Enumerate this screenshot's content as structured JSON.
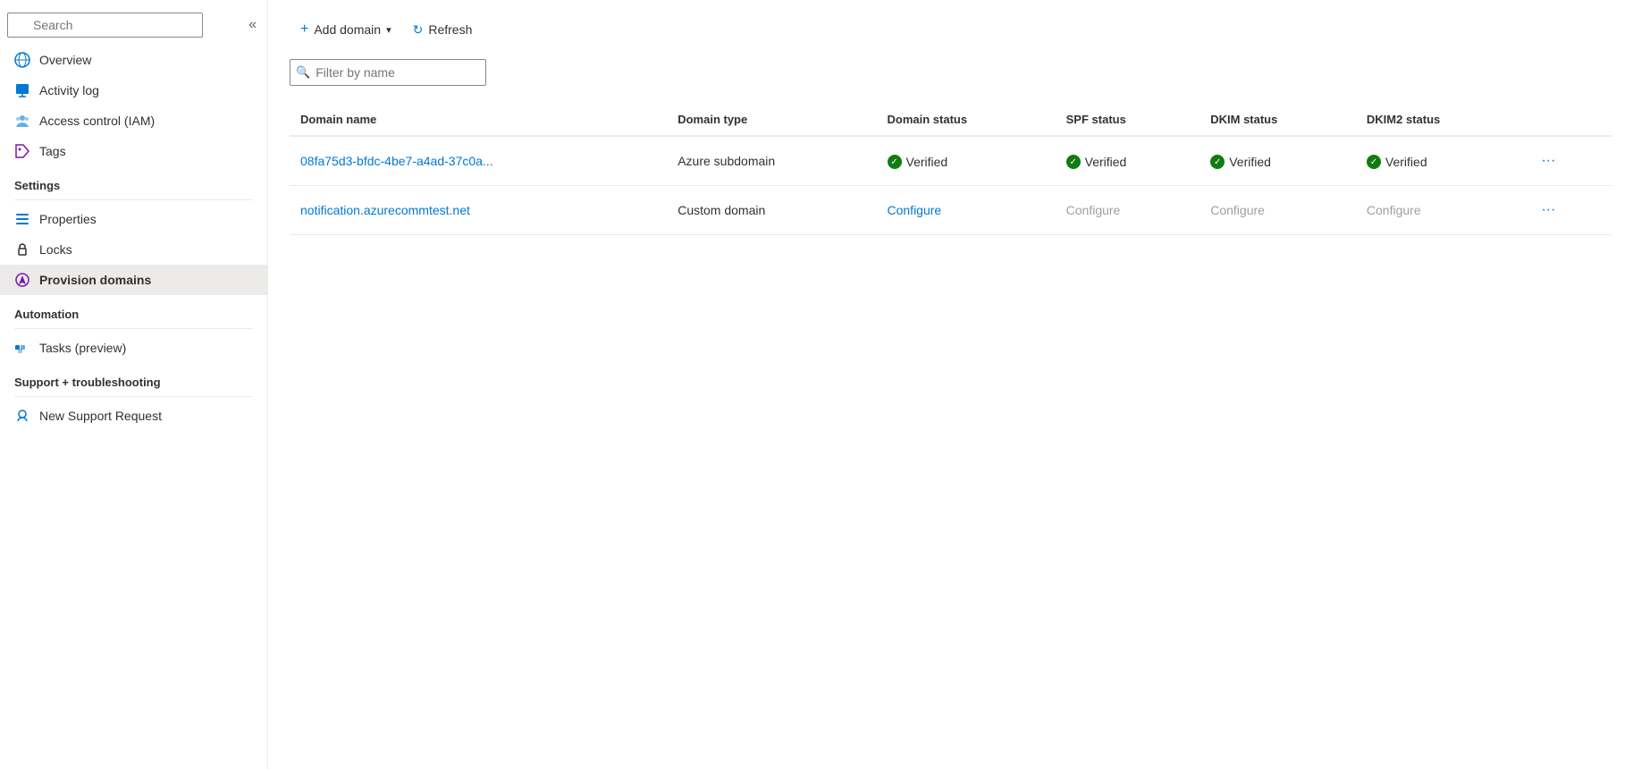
{
  "sidebar": {
    "search": {
      "placeholder": "Search",
      "value": ""
    },
    "collapse_label": "«",
    "nav_items": [
      {
        "id": "overview",
        "label": "Overview",
        "icon": "globe-icon",
        "active": false
      },
      {
        "id": "activity-log",
        "label": "Activity log",
        "icon": "activity-icon",
        "active": false
      },
      {
        "id": "access-control",
        "label": "Access control (IAM)",
        "icon": "iam-icon",
        "active": false
      },
      {
        "id": "tags",
        "label": "Tags",
        "icon": "tags-icon",
        "active": false
      }
    ],
    "sections": [
      {
        "label": "Settings",
        "items": [
          {
            "id": "properties",
            "label": "Properties",
            "icon": "properties-icon",
            "active": false
          },
          {
            "id": "locks",
            "label": "Locks",
            "icon": "locks-icon",
            "active": false
          },
          {
            "id": "provision-domains",
            "label": "Provision domains",
            "icon": "provision-icon",
            "active": true
          }
        ]
      },
      {
        "label": "Automation",
        "items": [
          {
            "id": "tasks",
            "label": "Tasks (preview)",
            "icon": "tasks-icon",
            "active": false
          }
        ]
      },
      {
        "label": "Support + troubleshooting",
        "items": [
          {
            "id": "new-support",
            "label": "New Support Request",
            "icon": "support-icon",
            "active": false
          }
        ]
      }
    ]
  },
  "toolbar": {
    "add_domain_label": "Add domain",
    "add_domain_dropdown": "▾",
    "refresh_label": "Refresh"
  },
  "filter": {
    "placeholder": "Filter by name"
  },
  "table": {
    "columns": [
      {
        "id": "domain-name",
        "label": "Domain name"
      },
      {
        "id": "domain-type",
        "label": "Domain type"
      },
      {
        "id": "domain-status",
        "label": "Domain status"
      },
      {
        "id": "spf-status",
        "label": "SPF status"
      },
      {
        "id": "dkim-status",
        "label": "DKIM status"
      },
      {
        "id": "dkim2-status",
        "label": "DKIM2 status"
      }
    ],
    "rows": [
      {
        "domain_name": "08fa75d3-bfdc-4be7-a4ad-37c0a...",
        "domain_type": "Azure subdomain",
        "domain_status": "Verified",
        "domain_status_type": "verified",
        "spf_status": "Verified",
        "spf_status_type": "verified",
        "dkim_status": "Verified",
        "dkim_status_type": "verified",
        "dkim2_status": "Verified",
        "dkim2_status_type": "verified"
      },
      {
        "domain_name": "notification.azurecommtest.net",
        "domain_type": "Custom domain",
        "domain_status": "Configure",
        "domain_status_type": "configure",
        "spf_status": "Configure",
        "spf_status_type": "configure-gray",
        "dkim_status": "Configure",
        "dkim_status_type": "configure-gray",
        "dkim2_status": "Configure",
        "dkim2_status_type": "configure-gray"
      }
    ]
  },
  "colors": {
    "accent": "#0078d4",
    "verified": "#107c10",
    "gray": "#a19f9d"
  }
}
